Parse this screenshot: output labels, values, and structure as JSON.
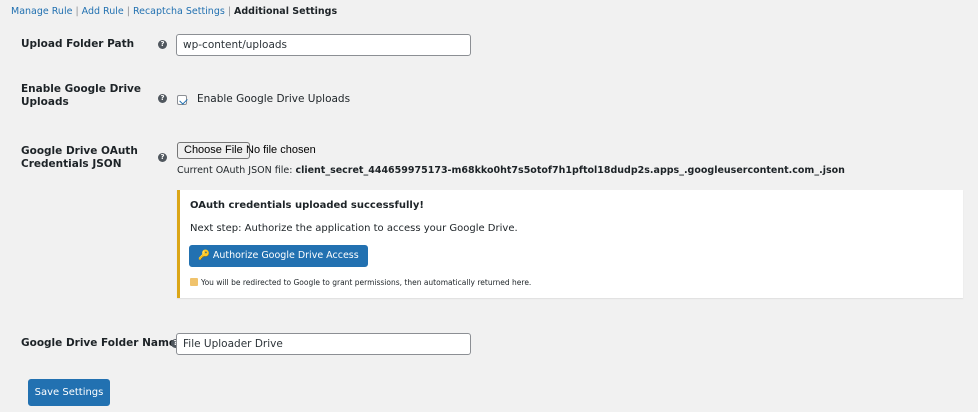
{
  "subnav": {
    "links": [
      "Manage Rule",
      "Add Rule",
      "Recaptcha Settings"
    ],
    "separator": "|",
    "current": "Additional Settings"
  },
  "help_icon_glyph": "?",
  "upload_folder": {
    "label": "Upload Folder Path",
    "value": "wp-content/uploads"
  },
  "enable_drive": {
    "label_line1": "Enable Google Drive",
    "label_line2": "Uploads",
    "checkbox_label": "Enable Google Drive Uploads",
    "checked": true
  },
  "oauth": {
    "label_line1": "Google Drive OAuth",
    "label_line2": "Credentials JSON",
    "file_button": "Choose File",
    "file_status": "No file chosen",
    "current_prefix": "Current OAuth JSON file:",
    "current_file": "client_secret_444659975173-m68kko0ht7s5otof7h1pftol18dudp2s.apps_.googleusercontent.com_.json"
  },
  "notice": {
    "title": "OAuth credentials uploaded successfully!",
    "text": "Next step: Authorize the application to access your Google Drive.",
    "button_icon": "key-icon",
    "button_label": "Authorize Google Drive Access",
    "note_icon": "memo-icon",
    "note": "You will be redirected to Google to grant permissions, then automatically returned here.",
    "accent_color": "#dba617"
  },
  "folder_name": {
    "label": "Google Drive Folder Name",
    "value": "File Uploader Drive"
  },
  "save_button": "Save Settings",
  "colors": {
    "primary": "#2271b1",
    "background": "#f1f1f1"
  }
}
